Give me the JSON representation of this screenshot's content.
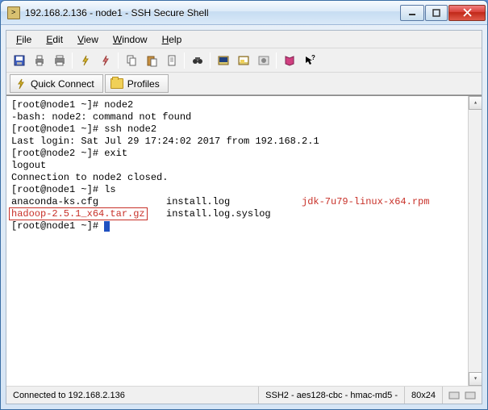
{
  "title": "192.168.2.136 - node1 - SSH Secure Shell",
  "menu": {
    "file": "File",
    "edit": "Edit",
    "view": "View",
    "window": "Window",
    "help": "Help"
  },
  "toolbar2": {
    "quick_connect": "Quick Connect",
    "profiles": "Profiles"
  },
  "terminal": {
    "l1": "[root@node1 ~]# node2",
    "l2": "-bash: node2: command not found",
    "l3": "[root@node1 ~]# ssh node2",
    "l4": "Last login: Sat Jul 29 17:24:02 2017 from 192.168.2.1",
    "l5": "[root@node2 ~]# exit",
    "l6": "logout",
    "l7": "Connection to node2 closed.",
    "l8": "[root@node1 ~]# ls",
    "l9a": "anaconda-ks.cfg",
    "l9b": "install.log",
    "l9c": "jdk-7u79-linux-x64.rpm",
    "l10a": "hadoop-2.5.1_x64.tar.gz",
    "l10b": "install.log.syslog",
    "l11": "[root@node1 ~]# "
  },
  "status": {
    "connected": "Connected to 192.168.2.136",
    "cipher": "SSH2 - aes128-cbc - hmac-md5 - ",
    "size": "80x24"
  }
}
